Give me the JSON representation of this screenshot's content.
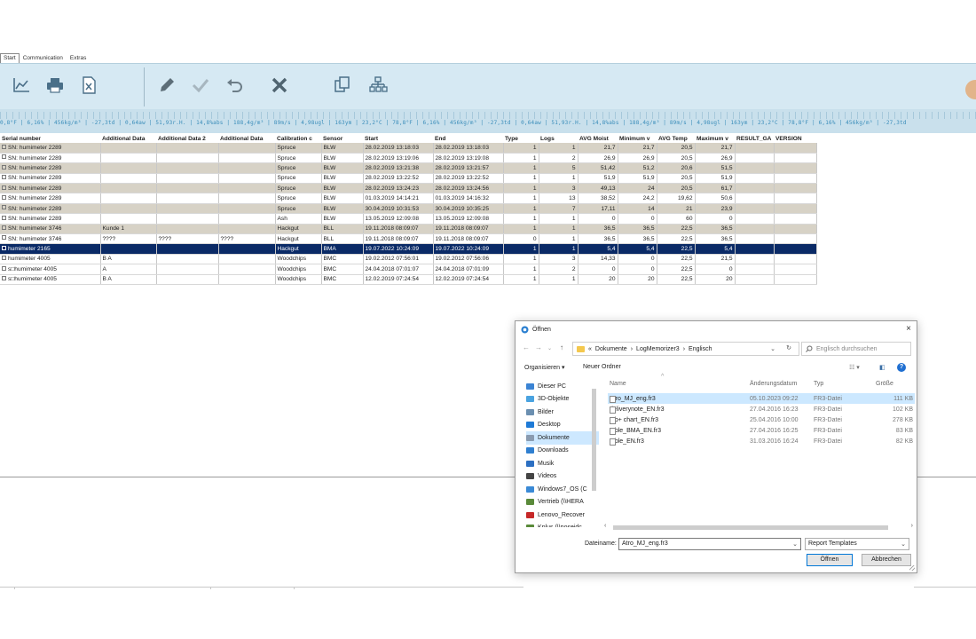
{
  "tabs": [
    "Start",
    "Communication",
    "Extras"
  ],
  "ruler_text": "0,8°F | 6,16% | 456kg/m³ | -27,3td | 0,64aw | 51,93r.H. | 14,8%abs | 188,4g/m³ | 89m/s | 4,98ugl | 163ym | 23,2°C | 78,8°F | 6,16% | 456kg/m³ | -27,3td | 0,64aw | 51,93r.H. | 14,8%abs | 188,4g/m³ | 89m/s | 4,98ugl | 163ym | 23,2°C | 78,8°F | 6,16% | 456kg/m³ | -27,3td",
  "grid": {
    "columns": [
      "Serial number",
      "Additional Data",
      "Additional Data 2",
      "Additional Data",
      "Calibration c",
      "Sensor",
      "Start",
      "End",
      "Type",
      "Logs",
      "AVG Moist",
      "Minimum v",
      "AVG Temp",
      "Maximum v",
      "RESULT_GA",
      "VERSION"
    ],
    "rows": [
      {
        "serial": "SN: humimeter  2289",
        "ad1": "",
        "ad2": "",
        "ad3": "",
        "cal": "Spruce",
        "sensor": "BLW",
        "start": "28.02.2019 13:18:03",
        "end": "28.02.2019 13:18:03",
        "type": "1",
        "logs": "1",
        "avg": "21,7",
        "min": "21,7",
        "temp": "20,5",
        "max": "21,7",
        "result": "",
        "version": ""
      },
      {
        "serial": "SN: humimeter  2289",
        "ad1": "",
        "ad2": "",
        "ad3": "",
        "cal": "Spruce",
        "sensor": "BLW",
        "start": "28.02.2019 13:19:06",
        "end": "28.02.2019 13:19:08",
        "type": "1",
        "logs": "2",
        "avg": "26,9",
        "min": "26,9",
        "temp": "20,5",
        "max": "26,9",
        "result": "",
        "version": ""
      },
      {
        "serial": "SN: humimeter  2289",
        "ad1": "",
        "ad2": "",
        "ad3": "",
        "cal": "Spruce",
        "sensor": "BLW",
        "start": "28.02.2019 13:21:38",
        "end": "28.02.2019 13:21:57",
        "type": "1",
        "logs": "5",
        "avg": "51,42",
        "min": "51,2",
        "temp": "20,6",
        "max": "51,5",
        "result": "",
        "version": ""
      },
      {
        "serial": "SN: humimeter  2289",
        "ad1": "",
        "ad2": "",
        "ad3": "",
        "cal": "Spruce",
        "sensor": "BLW",
        "start": "28.02.2019 13:22:52",
        "end": "28.02.2019 13:22:52",
        "type": "1",
        "logs": "1",
        "avg": "51,9",
        "min": "51,9",
        "temp": "20,5",
        "max": "51,9",
        "result": "",
        "version": ""
      },
      {
        "serial": "SN: humimeter  2289",
        "ad1": "",
        "ad2": "",
        "ad3": "",
        "cal": "Spruce",
        "sensor": "BLW",
        "start": "28.02.2019 13:24:23",
        "end": "28.02.2019 13:24:56",
        "type": "1",
        "logs": "3",
        "avg": "49,13",
        "min": "24",
        "temp": "20,5",
        "max": "61,7",
        "result": "",
        "version": ""
      },
      {
        "serial": "SN: humimeter  2289",
        "ad1": "",
        "ad2": "",
        "ad3": "",
        "cal": "Spruce",
        "sensor": "BLW",
        "start": "01.03.2019 14:14:21",
        "end": "01.03.2019 14:16:32",
        "type": "1",
        "logs": "13",
        "avg": "38,52",
        "min": "24,2",
        "temp": "19,62",
        "max": "50,6",
        "result": "",
        "version": ""
      },
      {
        "serial": "SN: humimeter  2289",
        "ad1": "",
        "ad2": "",
        "ad3": "",
        "cal": "Spruce",
        "sensor": "BLW",
        "start": "30.04.2019 10:31:53",
        "end": "30.04.2019 10:35:25",
        "type": "1",
        "logs": "7",
        "avg": "17,11",
        "min": "14",
        "temp": "21",
        "max": "23,9",
        "result": "",
        "version": ""
      },
      {
        "serial": "SN: humimeter  2289",
        "ad1": "",
        "ad2": "",
        "ad3": "",
        "cal": "Ash",
        "sensor": "BLW",
        "start": "13.05.2019 12:09:08",
        "end": "13.05.2019 12:09:08",
        "type": "1",
        "logs": "1",
        "avg": "0",
        "min": "0",
        "temp": "60",
        "max": "0",
        "result": "",
        "version": ""
      },
      {
        "serial": "SN: humimeter  3746",
        "ad1": "Kunde 1",
        "ad2": "",
        "ad3": "",
        "cal": "Hackgut",
        "sensor": "BLL",
        "start": "19.11.2018 08:09:07",
        "end": "19.11.2018 08:09:07",
        "type": "1",
        "logs": "1",
        "avg": "36,5",
        "min": "36,5",
        "temp": "22,5",
        "max": "36,5",
        "result": "",
        "version": ""
      },
      {
        "serial": "SN: humimeter  3746",
        "ad1": "????",
        "ad2": "????",
        "ad3": "????",
        "cal": "Hackgut",
        "sensor": "BLL",
        "start": "19.11.2018 08:09:07",
        "end": "19.11.2018 08:09:07",
        "type": "0",
        "logs": "1",
        "avg": "36,5",
        "min": "36,5",
        "temp": "22,5",
        "max": "36,5",
        "result": "",
        "version": ""
      },
      {
        "serial": "humimeter  2165",
        "ad1": "",
        "ad2": "",
        "ad3": "",
        "cal": "Hackgut",
        "sensor": "BMA",
        "start": "19.07.2022 10:24:09",
        "end": "19.07.2022 10:24:09",
        "type": "1",
        "logs": "1",
        "avg": "5,4",
        "min": "5,4",
        "temp": "22,5",
        "max": "5,4",
        "result": "",
        "version": ""
      },
      {
        "serial": "humimeter  4005",
        "ad1": "B A",
        "ad2": "",
        "ad3": "",
        "cal": "Woodchips",
        "sensor": "BMC",
        "start": "19.02.2012 07:56:01",
        "end": "19.02.2012 07:56:06",
        "type": "1",
        "logs": "3",
        "avg": "14,33",
        "min": "0",
        "temp": "22,5",
        "max": "21,5",
        "result": "",
        "version": ""
      },
      {
        "serial": "s□humimeter  4005",
        "ad1": "A",
        "ad2": "",
        "ad3": "",
        "cal": "Woodchips",
        "sensor": "BMC",
        "start": "24.04.2018 07:01:07",
        "end": "24.04.2018 07:01:09",
        "type": "1",
        "logs": "2",
        "avg": "0",
        "min": "0",
        "temp": "22,5",
        "max": "0",
        "result": "",
        "version": ""
      },
      {
        "serial": "s□humimeter  4005",
        "ad1": "B A",
        "ad2": "",
        "ad3": "",
        "cal": "Woodchips",
        "sensor": "BMC",
        "start": "12.02.2019 07:24:54",
        "end": "12.02.2019 07:24:54",
        "type": "1",
        "logs": "1",
        "avg": "20",
        "min": "20",
        "temp": "22,5",
        "max": "20",
        "result": "",
        "version": ""
      }
    ]
  },
  "dialog": {
    "title": "Öffnen",
    "close": "×",
    "path": [
      "«",
      "Dokumente",
      "›",
      "LogMemorizer3",
      "›",
      "Englisch"
    ],
    "search_placeholder": "Englisch durchsuchen",
    "organize": "Organisieren ▾",
    "new_folder": "Neuer Ordner",
    "nav": [
      {
        "label": "Dieser PC",
        "color": "#3b84d4"
      },
      {
        "label": "3D-Objekte",
        "color": "#4aa3e0"
      },
      {
        "label": "Bilder",
        "color": "#6b8fb0"
      },
      {
        "label": "Desktop",
        "color": "#1e7ad6"
      },
      {
        "label": "Dokumente",
        "color": "#8a9bb0"
      },
      {
        "label": "Downloads",
        "color": "#2f7fd0"
      },
      {
        "label": "Musik",
        "color": "#2c6fc2"
      },
      {
        "label": "Videos",
        "color": "#444444"
      },
      {
        "label": "Windows7_OS (C",
        "color": "#3a8ad6"
      },
      {
        "label": "Vertrieb (\\\\HERA",
        "color": "#5a8a3a"
      },
      {
        "label": "Lenovo_Recover",
        "color": "#c62828"
      },
      {
        "label": "Kplus (\\\\poseidc",
        "color": "#5a8a3a"
      }
    ],
    "columns": {
      "name": "Name",
      "date": "Änderungsdatum",
      "type": "Typ",
      "size": "Größe"
    },
    "files": [
      {
        "name": "Atro_MJ_eng.fr3",
        "date": "05.10.2023 09:22",
        "type": "FR3-Datei",
        "size": "111 KB"
      },
      {
        "name": "deliverynote_EN.fr3",
        "date": "27.04.2016 16:23",
        "type": "FR3-Datei",
        "size": "102 KB"
      },
      {
        "name": "tab+ chart_EN.fr3",
        "date": "25.04.2016 10:00",
        "type": "FR3-Datei",
        "size": "278 KB"
      },
      {
        "name": "table_BMA_EN.fr3",
        "date": "27.04.2016 16:25",
        "type": "FR3-Datei",
        "size": "83 KB"
      },
      {
        "name": "table_EN.fr3",
        "date": "31.03.2016 16:24",
        "type": "FR3-Datei",
        "size": "82 KB"
      }
    ],
    "filename_label": "Dateiname:",
    "filename_value": "Atro_MJ_eng.fr3",
    "filetype": "Report Templates",
    "open_button": "Öffnen",
    "cancel_button": "Abbrechen"
  }
}
